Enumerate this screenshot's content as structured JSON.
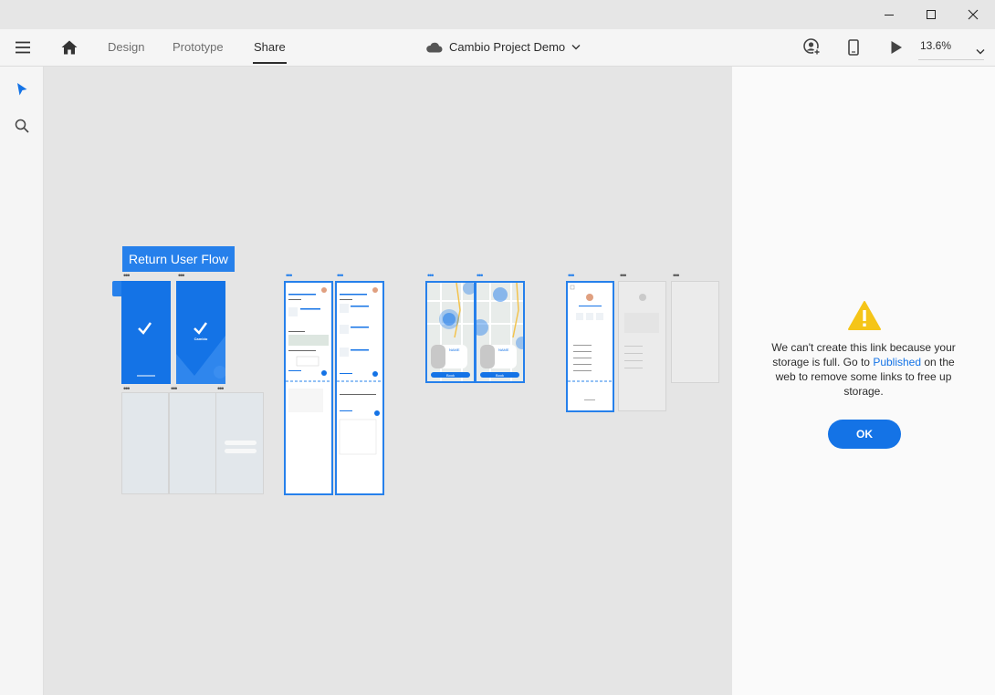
{
  "window": {
    "minimize_icon": "minimize-icon",
    "maximize_icon": "maximize-icon",
    "close_icon": "close-icon"
  },
  "appbar": {
    "tabs": [
      {
        "label": "Design",
        "active": false
      },
      {
        "label": "Prototype",
        "active": false
      },
      {
        "label": "Share",
        "active": true
      }
    ],
    "document_title": "Cambio Project Demo",
    "zoom": "13.6%"
  },
  "canvas": {
    "flow_name": "Return User Flow",
    "map_card_labels": [
      "NAME",
      "NAME"
    ],
    "map_button_labels": [
      "Book",
      "Book"
    ],
    "splash_brand": "Cambio"
  },
  "share_panel": {
    "message_before": "We can't create this link because your storage is full. Go to ",
    "message_link": "Published",
    "message_after": " on the web to remove some links to free up storage.",
    "ok_label": "OK"
  },
  "colors": {
    "accent": "#1473e6",
    "selection": "#2680eb",
    "warning": "#f5c518"
  }
}
